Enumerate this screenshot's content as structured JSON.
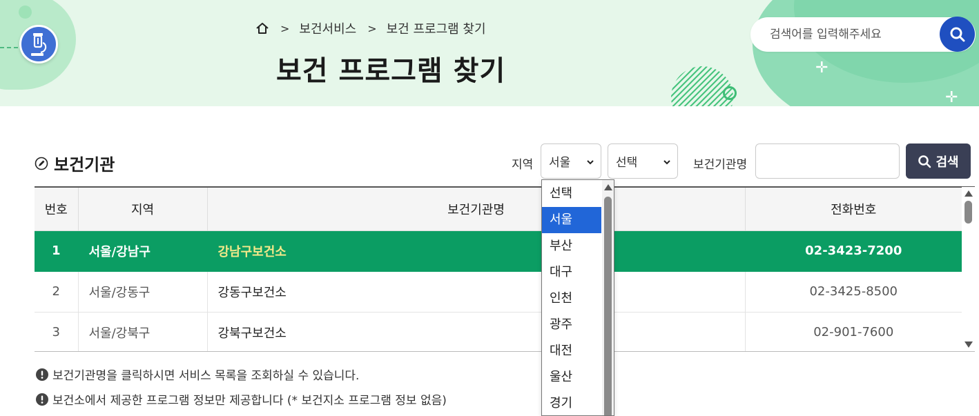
{
  "header": {
    "breadcrumb": {
      "home_icon": "home-icon",
      "items": [
        "보건서비스",
        "보건 프로그램 찾기"
      ]
    },
    "title": "보건 프로그램 찾기",
    "search": {
      "placeholder": "검색어를 입력해주세요",
      "icon": "search-icon"
    },
    "accent_color": "#1f4fc0",
    "banner_color": "#e6f7ea"
  },
  "section": {
    "title": "보건기관",
    "icon": "edit-circle-icon"
  },
  "filters": {
    "region_label": "지역",
    "region_value": "서울",
    "district_value": "선택",
    "org_name_label": "보건기관명",
    "org_name_value": "",
    "search_button": "검색"
  },
  "region_options": [
    "선택",
    "서울",
    "부산",
    "대구",
    "인천",
    "광주",
    "대전",
    "울산",
    "경기"
  ],
  "table": {
    "columns": [
      "번호",
      "지역",
      "보건기관명",
      "전화번호"
    ],
    "rows": [
      {
        "num": "1",
        "region": "서울/강남구",
        "name": "강남구보건소",
        "phone": "02-3423-7200"
      },
      {
        "num": "2",
        "region": "서울/강동구",
        "name": "강동구보건소",
        "phone": "02-3425-8500"
      },
      {
        "num": "3",
        "region": "서울/강북구",
        "name": "강북구보건소",
        "phone": "02-901-7600"
      }
    ],
    "active_row_color": "#0b9d63"
  },
  "notes": [
    "보건기관명을 클릭하시면 서비스 목록을 조회하실 수 있습니다.",
    "보건소에서 제공한 프로그램 정보만 제공합니다 (* 보건지소 프로그램 정보 없음)"
  ]
}
